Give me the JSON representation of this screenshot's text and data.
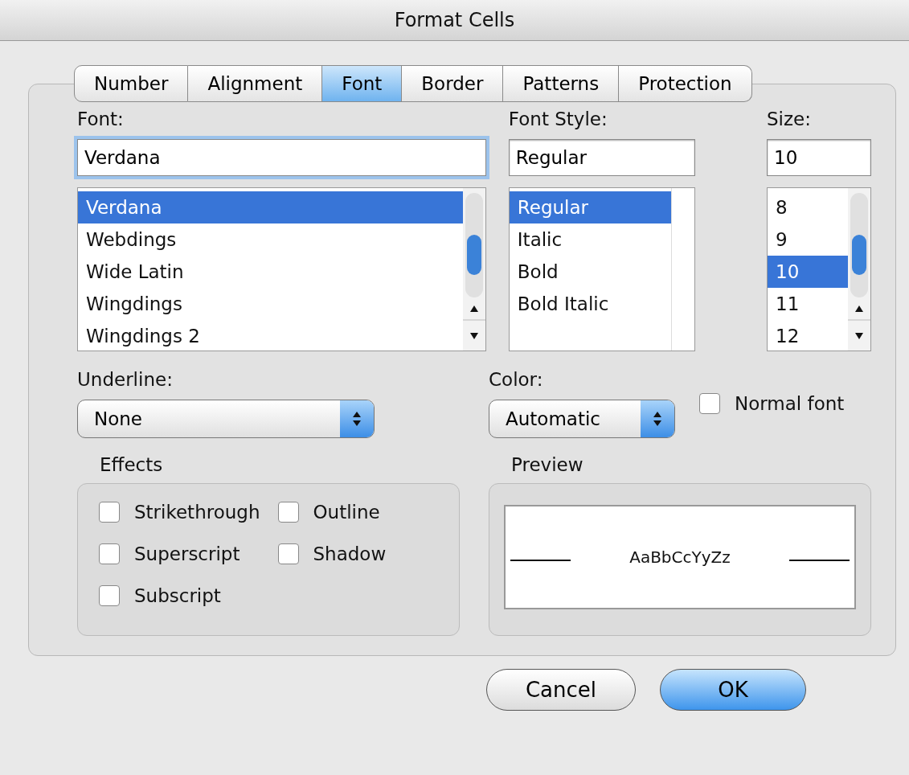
{
  "window": {
    "title": "Format Cells"
  },
  "tabs": [
    {
      "label": "Number",
      "selected": false
    },
    {
      "label": "Alignment",
      "selected": false
    },
    {
      "label": "Font",
      "selected": true
    },
    {
      "label": "Border",
      "selected": false
    },
    {
      "label": "Patterns",
      "selected": false
    },
    {
      "label": "Protection",
      "selected": false
    }
  ],
  "font": {
    "label": "Font:",
    "value": "Verdana",
    "focused": true,
    "scrollbar": true,
    "options": [
      {
        "label": "Verdana",
        "selected": true
      },
      {
        "label": "Webdings",
        "selected": false
      },
      {
        "label": "Wide Latin",
        "selected": false
      },
      {
        "label": "Wingdings",
        "selected": false
      },
      {
        "label": "Wingdings 2",
        "selected": false
      }
    ]
  },
  "font_style": {
    "label": "Font Style:",
    "value": "Regular",
    "focused": false,
    "scrollbar": false,
    "options": [
      {
        "label": "Regular",
        "selected": true
      },
      {
        "label": "Italic",
        "selected": false
      },
      {
        "label": "Bold",
        "selected": false
      },
      {
        "label": "Bold Italic",
        "selected": false
      }
    ]
  },
  "size": {
    "label": "Size:",
    "value": "10",
    "focused": false,
    "scrollbar": true,
    "options": [
      {
        "label": "8",
        "selected": false
      },
      {
        "label": "9",
        "selected": false
      },
      {
        "label": "10",
        "selected": true
      },
      {
        "label": "11",
        "selected": false
      },
      {
        "label": "12",
        "selected": false
      }
    ]
  },
  "underline": {
    "label": "Underline:",
    "value": "None"
  },
  "color": {
    "label": "Color:",
    "value": "Automatic"
  },
  "normal_font": {
    "label": "Normal font",
    "checked": false
  },
  "effects": {
    "title": "Effects",
    "options": [
      {
        "label": "Strikethrough",
        "checked": false
      },
      {
        "label": "Outline",
        "checked": false
      },
      {
        "label": "Superscript",
        "checked": false
      },
      {
        "label": "Shadow",
        "checked": false
      },
      {
        "label": "Subscript",
        "checked": false
      }
    ]
  },
  "preview": {
    "title": "Preview",
    "sample": "AaBbCcYyZz"
  },
  "buttons": [
    {
      "label": "Cancel",
      "kind": "normal"
    },
    {
      "label": "OK",
      "kind": "default"
    }
  ]
}
